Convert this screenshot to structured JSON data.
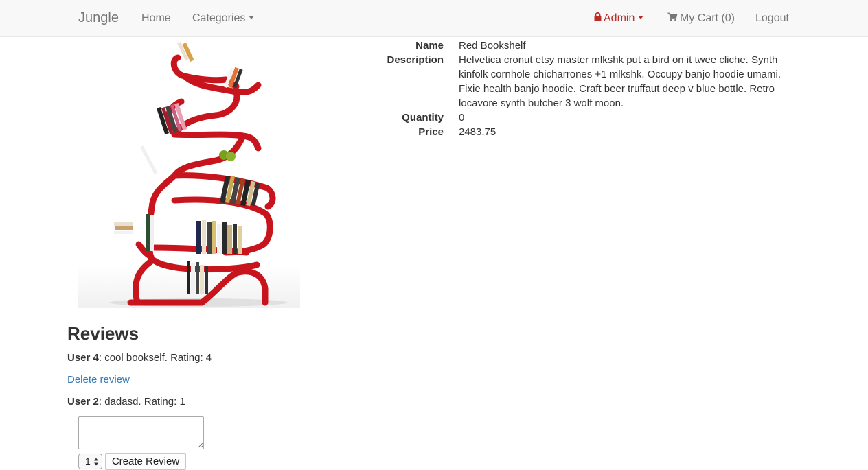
{
  "navbar": {
    "brand": "Jungle",
    "home": "Home",
    "categories": "Categories",
    "admin": "Admin",
    "cart": "My Cart (0)",
    "logout": "Logout",
    "admin_color": "#b92c28"
  },
  "product": {
    "image_icon": "red-bookshelf-image",
    "labels": {
      "name": "Name",
      "description": "Description",
      "quantity": "Quantity",
      "price": "Price"
    },
    "name": "Red Bookshelf",
    "description": "Helvetica cronut etsy master mlkshk put a bird on it twee cliche. Synth kinfolk cornhole chicharrones +1 mlkshk. Occupy banjo hoodie umami. Fixie health banjo hoodie. Craft beer truffaut deep v blue bottle. Retro locavore synth butcher 3 wolf moon.",
    "quantity": "0",
    "price": "2483.75"
  },
  "reviews": {
    "title": "Reviews",
    "items": [
      {
        "user": "User 4",
        "text": ": cool bookself. Rating: 4"
      },
      {
        "user": "User 2",
        "text": ": dadasd. Rating: 1"
      }
    ],
    "delete_label": "Delete review",
    "form": {
      "textarea_value": "",
      "rating_value": "1",
      "submit_label": "Create Review"
    }
  }
}
